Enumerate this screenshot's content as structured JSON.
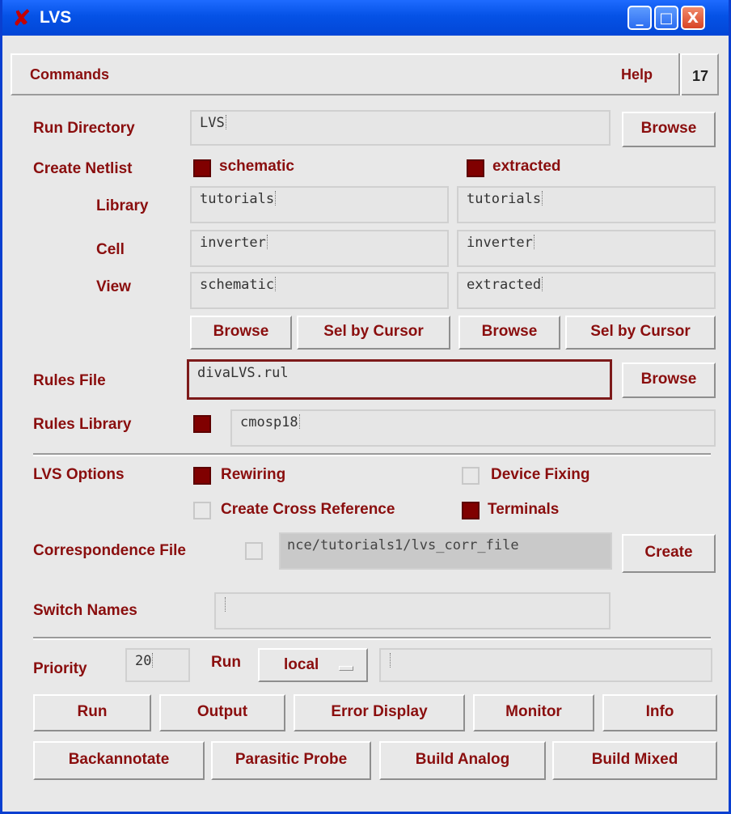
{
  "window": {
    "title": "LVS",
    "minimize": "_",
    "maximize": "□",
    "close": "X"
  },
  "menubar": {
    "commands": "Commands",
    "help": "Help",
    "page_number": "17"
  },
  "run_directory": {
    "label": "Run Directory",
    "value": "LVS",
    "browse": "Browse"
  },
  "create_netlist": {
    "label": "Create Netlist",
    "schematic": {
      "label": "schematic",
      "checked": true
    },
    "extracted": {
      "label": "extracted",
      "checked": true
    },
    "library_label": "Library",
    "cell_label": "Cell",
    "view_label": "View",
    "schematic_library": "tutorials",
    "schematic_cell": "inverter",
    "schematic_view": "schematic",
    "extracted_library": "tutorials",
    "extracted_cell": "inverter",
    "extracted_view": "extracted",
    "browse_left": "Browse",
    "sel_cursor_left": "Sel by Cursor",
    "browse_right": "Browse",
    "sel_cursor_right": "Sel by Cursor"
  },
  "rules_file": {
    "label": "Rules File",
    "value": "divaLVS.rul",
    "browse": "Browse"
  },
  "rules_library": {
    "label": "Rules Library",
    "checked": true,
    "value": "cmosp18"
  },
  "lvs_options": {
    "label": "LVS Options",
    "rewiring": {
      "label": "Rewiring",
      "checked": true
    },
    "device_fixing": {
      "label": "Device Fixing",
      "checked": false
    },
    "cross_reference": {
      "label": "Create Cross Reference",
      "checked": false
    },
    "terminals": {
      "label": "Terminals",
      "checked": true
    }
  },
  "correspondence": {
    "label": "Correspondence File",
    "checked": false,
    "value": "nce/tutorials1/lvs_corr_file",
    "create": "Create"
  },
  "switch_names": {
    "label": "Switch Names",
    "value": ""
  },
  "priority": {
    "label": "Priority",
    "value": "20",
    "run_label": "Run",
    "run_mode": "local",
    "host": ""
  },
  "actions_row1": [
    "Run",
    "Output",
    "Error Display",
    "Monitor",
    "Info"
  ],
  "actions_row2": [
    "Backannotate",
    "Parasitic Probe",
    "Build Analog",
    "Build Mixed"
  ],
  "colors": {
    "accent": "#800000",
    "title_bar": "#0552e6",
    "background": "#e8e8e8"
  }
}
